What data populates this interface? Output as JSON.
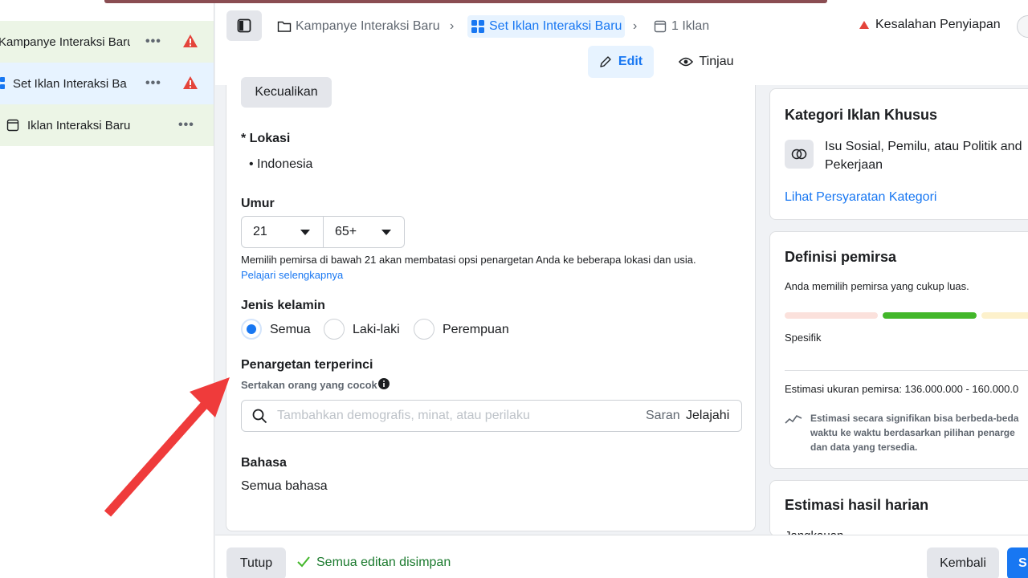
{
  "sidebar": {
    "items": [
      {
        "label": "Kampanye Interaksi Baru",
        "more": "•••",
        "has_warning": true
      },
      {
        "label": "Set Iklan Interaksi Baru",
        "more": "•••",
        "has_warning": true
      },
      {
        "label": "Iklan Interaksi Baru",
        "more": "•••",
        "has_warning": false
      }
    ]
  },
  "header": {
    "breadcrumbs": [
      {
        "label": "Kampanye Interaksi Baru",
        "icon": "folder-icon"
      },
      {
        "label": "Set Iklan Interaksi Baru",
        "icon": "grid-icon"
      },
      {
        "label": "1 Iklan",
        "icon": "ad-icon"
      }
    ],
    "error_status": "Kesalahan Penyiapan",
    "edit_label": "Edit",
    "review_label": "Tinjau"
  },
  "form": {
    "exclude_button": "Kecualikan",
    "location_label": "* Lokasi",
    "location_value": "• Indonesia",
    "age_label": "Umur",
    "age_min": "21",
    "age_max": "65+",
    "age_note": "Memilih pemirsa di bawah 21 akan membatasi opsi penargetan Anda ke beberapa lokasi dan usia.",
    "age_learn_more": "Pelajari selengkapnya",
    "gender_label": "Jenis kelamin",
    "gender_options": [
      "Semua",
      "Laki-laki",
      "Perempuan"
    ],
    "gender_selected": "Semua",
    "detailed_targeting_label": "Penargetan terperinci",
    "detailed_targeting_sub": "Sertakan orang yang cocok",
    "search_placeholder": "Tambahkan demografis, minat, atau perilaku",
    "search_suggestions": "Saran",
    "search_browse": "Jelajahi",
    "language_label": "Bahasa",
    "language_value": "Semua bahasa"
  },
  "right": {
    "special_category_title": "Kategori Iklan Khusus",
    "special_category_text_1": "Isu Sosial, Pemilu, atau Politik and",
    "special_category_text_2": "Pekerjaan",
    "special_category_link": "Lihat Persyaratan Kategori",
    "audience_title": "Definisi pemirsa",
    "audience_text": "Anda memilih pemirsa yang cukup luas.",
    "audience_scale_label": "Spesifik",
    "audience_size": "Estimasi ukuran pemirsa: 136.000.000 - 160.000.0",
    "estimate_note_1": "Estimasi secara signifikan bisa berbeda-beda",
    "estimate_note_2": "waktu ke waktu berdasarkan pilihan penarge",
    "estimate_note_3": "dan data yang tersedia.",
    "daily_results_title": "Estimasi hasil harian",
    "daily_results_sub": "Jangkauan"
  },
  "footer": {
    "close_label": "Tutup",
    "saved_status": "Semua editan disimpan",
    "back_label": "Kembali",
    "primary_label": "S"
  },
  "colors": {
    "accent": "#1877f2",
    "warning": "#e4443b",
    "success": "#42b72a",
    "annotation_arrow": "#ef3b3b"
  }
}
